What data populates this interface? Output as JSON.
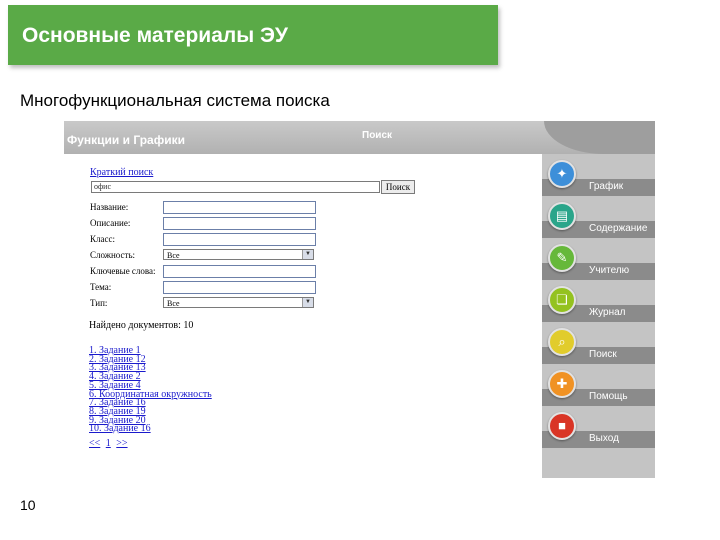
{
  "slide": {
    "title": "Основные материалы ЭУ",
    "subtitle": "Многофункциональная система поиска",
    "page_number": "10"
  },
  "app": {
    "header_title": "Функции и Графики",
    "header_search": "Поиск"
  },
  "quick_search": {
    "link": "Краткий поиск",
    "value": "офис",
    "button": "Поиск"
  },
  "form": {
    "fields": [
      {
        "label": "Название:"
      },
      {
        "label": "Описание:"
      },
      {
        "label": "Класс:"
      },
      {
        "label": "Сложность:",
        "value": "Все"
      },
      {
        "label": "Ключевые слова:"
      },
      {
        "label": "Тема:"
      },
      {
        "label": "Тип:",
        "value": "Все"
      }
    ]
  },
  "results": {
    "count_text": "Найдено документов: 10",
    "items": [
      "1. Задание 1",
      "2. Задание 12",
      "3. Задание 13",
      "4. Задание 2",
      "5. Задание 4",
      "6. Координатная окружность",
      "7. Задание 16",
      "8. Задание 19",
      "9. Задание 20",
      "10. Задание 16"
    ],
    "pager": {
      "prev": "<<",
      "page": "1",
      "next": ">>"
    }
  },
  "sidebar": {
    "items": [
      {
        "label": "График",
        "icon": "graph-icon",
        "color": "#3d8fd9"
      },
      {
        "label": "Содержание",
        "icon": "contents-icon",
        "color": "#2aa58a"
      },
      {
        "label": "Учителю",
        "icon": "teacher-icon",
        "color": "#66b83a"
      },
      {
        "label": "Журнал",
        "icon": "journal-icon",
        "color": "#94c21f"
      },
      {
        "label": "Поиск",
        "icon": "search-icon",
        "color": "#e1cc2c"
      },
      {
        "label": "Помощь",
        "icon": "help-icon",
        "color": "#f09224"
      },
      {
        "label": "Выход",
        "icon": "exit-icon",
        "color": "#d93526"
      }
    ]
  },
  "colors": {
    "title_bar": "#5aaa47",
    "header_bar": "#b9b9b9",
    "sidebar": "#c4c4c4",
    "link": "#1a1acc"
  }
}
